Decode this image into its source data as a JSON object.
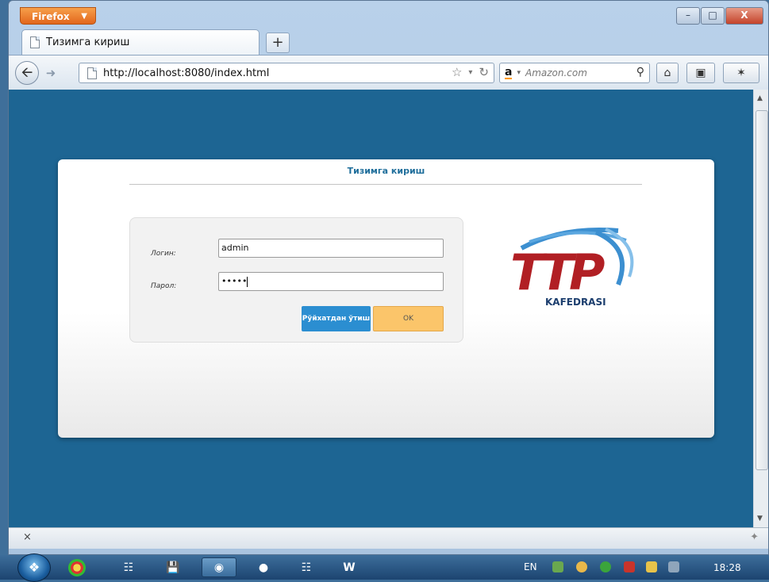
{
  "browser": {
    "menu_label": "Firefox",
    "window_buttons": {
      "minimize": "–",
      "maximize": "□",
      "close": "X"
    },
    "tab_title": "Тизимга кириш",
    "new_tab": "+",
    "url": "http://localhost:8080/index.html",
    "search_placeholder": "Amazon.com",
    "search_engine_glyph": "a"
  },
  "page": {
    "card_title": "Тизимга кириш",
    "login_label": "Логин:",
    "login_value": "admin",
    "password_label": "Парол:",
    "password_value": "•••••",
    "register_button": "Рўйхатдан ўтиш",
    "ok_button": "OK",
    "logo_text": "KAFEDRASI"
  },
  "statusbar": {
    "close_glyph": "×"
  },
  "taskbar": {
    "language": "EN",
    "clock": "18:28"
  },
  "colors": {
    "page_background": "#1d6593",
    "title_color": "#1f6e9b",
    "register_button": "#2b8ed1",
    "ok_button": "#fbc56a",
    "logo_red": "#b11f24"
  }
}
